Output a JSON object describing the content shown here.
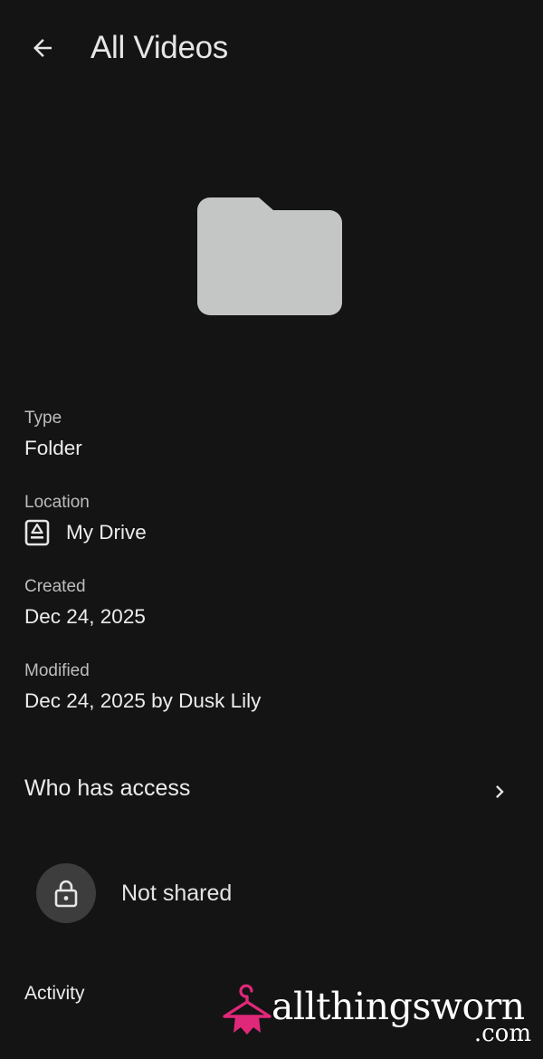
{
  "header": {
    "title": "All Videos"
  },
  "hero": {
    "icon": "folder-icon",
    "color": "#c4c6c5"
  },
  "details": {
    "type": {
      "label": "Type",
      "value": "Folder"
    },
    "location": {
      "label": "Location",
      "value": "My Drive",
      "icon": "drive-icon"
    },
    "created": {
      "label": "Created",
      "value": "Dec 24, 2025"
    },
    "modified": {
      "label": "Modified",
      "value": "Dec 24, 2025 by Dusk Lily"
    }
  },
  "access": {
    "title": "Who has access",
    "status": "Not shared",
    "status_icon": "lock-icon"
  },
  "activity": {
    "title": "Activity"
  },
  "watermark": {
    "brand": "allthingsworn",
    "tld": ".com",
    "accent": "#e0287a"
  },
  "colors": {
    "background": "#141414",
    "text": "#ececec",
    "muted": "#bdbdbd"
  }
}
